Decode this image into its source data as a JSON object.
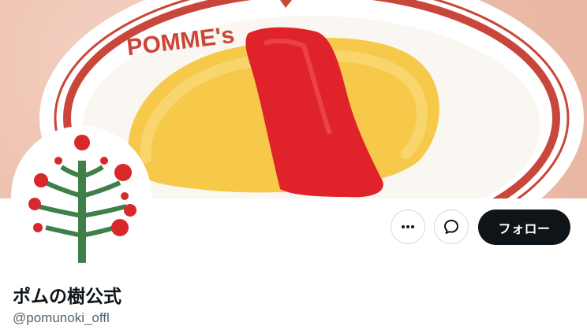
{
  "banner": {
    "plate_logo_text": "POMME's",
    "alt": "banner-image"
  },
  "profile": {
    "display_name": "ポムの樹公式",
    "handle": "@pomunoki_offl"
  },
  "actions": {
    "more_icon": "more-horizontal-icon",
    "message_icon": "message-bubble-icon",
    "follow_label": "フォロー"
  },
  "colors": {
    "follow_bg": "#0f1419",
    "follow_text": "#ffffff",
    "handle_text": "#536471",
    "plate_red": "#c8473a",
    "ketchup": "#e0232b",
    "omelette": "#f6c94a",
    "tree_green": "#3f7f4a",
    "berry_red": "#d8282c"
  }
}
